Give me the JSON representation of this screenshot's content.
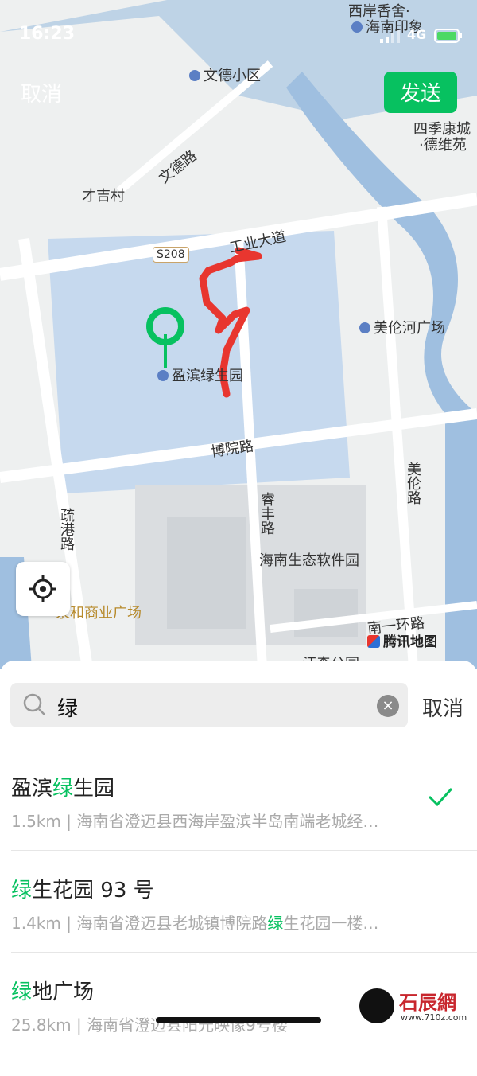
{
  "status_bar": {
    "time": "16:23",
    "network": "4G"
  },
  "top_bar": {
    "cancel_label": "取消",
    "send_label": "发送"
  },
  "map": {
    "attribution": "腾讯地图",
    "labels": {
      "xianxiang": "西岸香舍·",
      "hainanyinxiang": "海南印象",
      "wende_community": "文德小区",
      "siji_1": "四季康城",
      "siji_2": "·德维苑",
      "wende_road": "文德路",
      "caiji": "才吉村",
      "s208": "S208",
      "gongye": "工业大道",
      "meilunhe": "美伦河广场",
      "yingbin": "盈滨绿生园",
      "boyuan": "博院路",
      "ruifeng": "睿丰路",
      "meilun_road": "美伦路",
      "shugang": "疏港路",
      "software_park": "海南生态软件园",
      "commerce": "泉和商业广场",
      "ring": "南一环路",
      "park": "汪森公园"
    }
  },
  "search": {
    "query": "绿",
    "cancel_label": "取消"
  },
  "results": [
    {
      "pre": "盈滨",
      "hl": "绿",
      "post": "生园",
      "distance": "1.5km",
      "addr_pre": "海南省澄迈县西海岸盈滨半岛南端老城经…",
      "addr_hl": "",
      "addr_post": "",
      "selected": true
    },
    {
      "pre": "",
      "hl": "绿",
      "post": "生花园 93 号",
      "distance": "1.4km",
      "addr_pre": "海南省澄迈县老城镇博院路",
      "addr_hl": "绿",
      "addr_post": "生花园一楼…",
      "selected": false
    },
    {
      "pre": "",
      "hl": "绿",
      "post": "地广场",
      "distance": "25.8km",
      "addr_pre": "海南省澄迈县阳光映像9号楼",
      "addr_hl": "",
      "addr_post": "",
      "selected": false
    }
  ],
  "colors": {
    "accent": "#07c160",
    "annotation": "#e8362f"
  },
  "watermark": {
    "text": "石辰網",
    "url": "www.710z.com"
  }
}
